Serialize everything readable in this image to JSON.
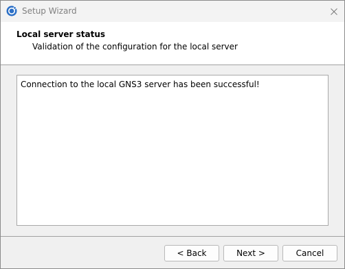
{
  "window": {
    "title": "Setup Wizard"
  },
  "header": {
    "title": "Local server status",
    "subtitle": "Validation of the configuration for the local server"
  },
  "content": {
    "message": "Connection to the local GNS3 server has been successful!"
  },
  "buttons": {
    "back": "< Back",
    "next": "Next >",
    "cancel": "Cancel"
  },
  "icons": {
    "app": "gns3-app-icon",
    "close": "close-icon"
  },
  "colors": {
    "app_icon_blue": "#2b6fc6"
  }
}
